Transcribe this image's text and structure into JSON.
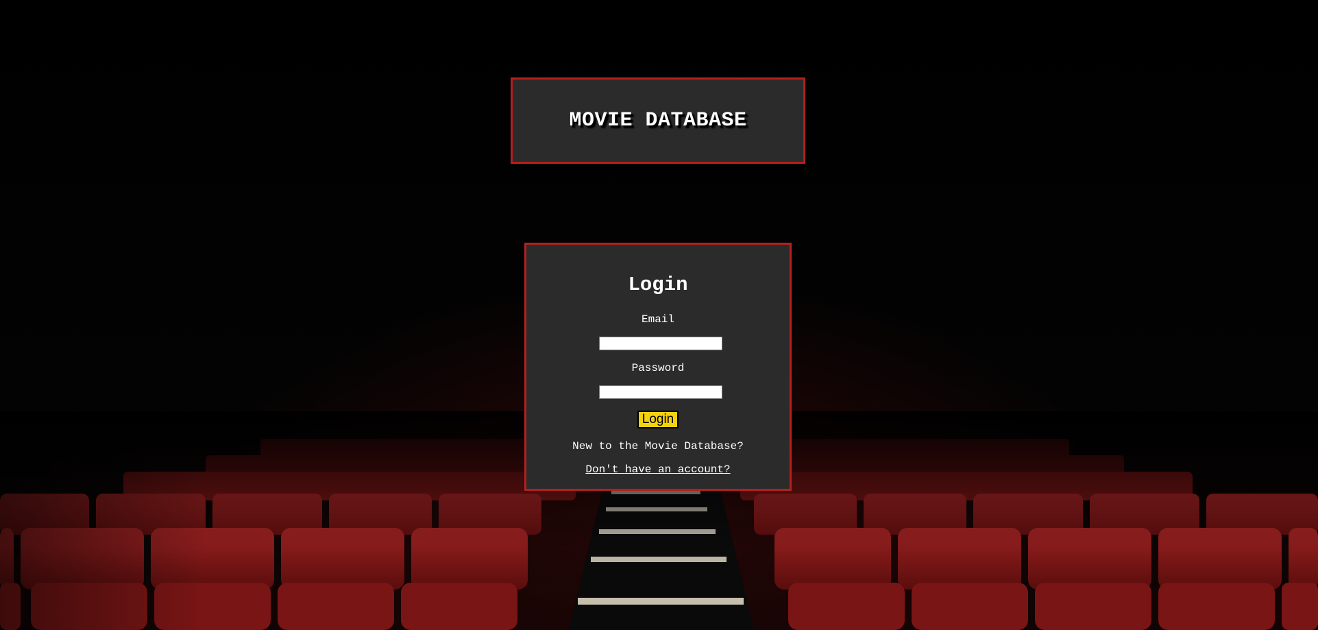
{
  "header": {
    "title": "MOVIE DATABASE"
  },
  "login": {
    "heading": "Login",
    "email_label": "Email",
    "email_value": "",
    "password_label": "Password",
    "password_value": "",
    "submit_label": "Login",
    "new_user_text": "New to the Movie Database?",
    "signup_link": "Don't have an account?"
  },
  "colors": {
    "panel_background": "#2b2b2b",
    "panel_border": "#b3201e",
    "button_background": "#f4d20f",
    "seat_red": "#8e1a1a"
  },
  "background": {
    "scene": "theater-seats-image"
  }
}
